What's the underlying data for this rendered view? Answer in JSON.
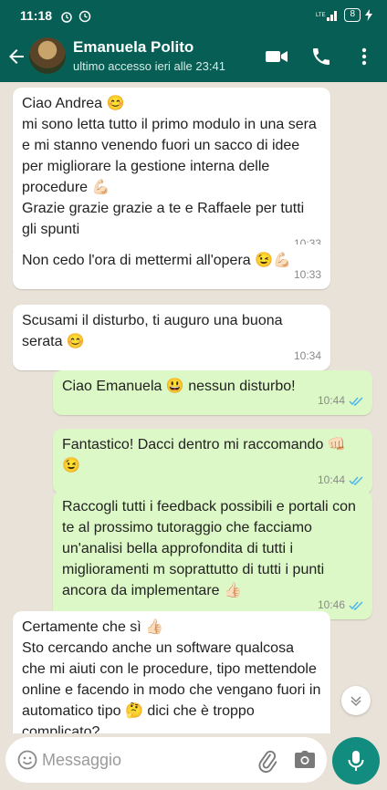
{
  "status_bar": {
    "time": "11:18",
    "battery": "8"
  },
  "header": {
    "contact_name": "Emanuela Polito",
    "last_seen": "ultimo accesso ieri alle 23:41"
  },
  "messages": [
    {
      "direction": "in",
      "text": "Ciao Andrea 😊\nmi sono letta tutto il primo modulo in una sera e mi stanno venendo fuori un sacco di idee per migliorare la gestione interna delle procedure 💪🏻\nGrazie grazie grazie a te e Raffaele per tutti gli spunti",
      "time": "10:33"
    },
    {
      "direction": "in",
      "text": "Non cedo l'ora di mettermi all'opera 😉💪🏻",
      "time": "10:33"
    },
    {
      "direction": "in",
      "text": "Scusami il disturbo, ti auguro una buona serata 😊",
      "time": "10:34"
    },
    {
      "direction": "out",
      "text": "Ciao Emanuela 😃 nessun disturbo!",
      "time": "10:44",
      "read": true
    },
    {
      "direction": "out",
      "text": "Fantastico! Dacci dentro mi raccomando 👊🏻😉",
      "time": "10:44",
      "read": true
    },
    {
      "direction": "out",
      "text": "Raccogli tutti i feedback possibili e portali con te al prossimo tutoraggio che facciamo un'analisi bella approfondita di tutti i miglioramenti m soprattutto di tutti i punti ancora da implementare 👍🏻",
      "time": "10:46",
      "read": true
    },
    {
      "direction": "in",
      "text": "Certamente che sì 👍🏻\nSto cercando anche un software qualcosa che mi aiuti con le procedure, tipo mettendole online e facendo in modo che vengano fuori in automatico tipo 🤔 dici che è troppo complicato?",
      "time": ""
    }
  ],
  "composer": {
    "placeholder": "Messaggio"
  },
  "colors": {
    "header": "#075e54",
    "outgoing": "#dcf8c6",
    "incoming": "#ffffff",
    "read_ticks": "#4fb6ec",
    "mic": "#128c7e"
  },
  "icons": [
    "back-arrow-icon",
    "video-call-icon",
    "phone-icon",
    "more-vert-icon",
    "emoji-icon",
    "attach-icon",
    "camera-icon",
    "mic-icon",
    "chevron-down-icon"
  ]
}
